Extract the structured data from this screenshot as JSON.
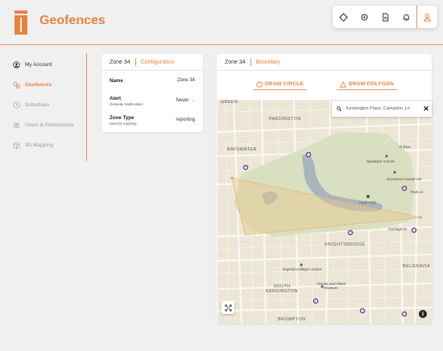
{
  "app": {
    "title": "Geofences"
  },
  "toolbar": {
    "items": [
      {
        "icon": "diamond-icon"
      },
      {
        "icon": "gear-icon"
      },
      {
        "icon": "document-icon"
      },
      {
        "icon": "bell-icon"
      },
      {
        "icon": "user-icon"
      }
    ]
  },
  "sidebar": {
    "items": [
      {
        "label": "My Account",
        "icon": "user-circle-icon"
      },
      {
        "label": "Geofences",
        "icon": "geofence-icon",
        "active": true
      },
      {
        "label": "Schedules",
        "icon": "clock-icon"
      },
      {
        "label": "Users & Permissions",
        "icon": "users-icon"
      },
      {
        "label": "3D Mapping",
        "icon": "cube-icon"
      }
    ]
  },
  "config": {
    "zone": "Zone 34",
    "tab": "Configuration",
    "name_label": "Name",
    "name_value": "Zone 34",
    "alert_label": "Alert",
    "alert_sub": "Generate Notifications",
    "alert_value": "Never",
    "zone_type_label": "Zone Type",
    "zone_type_sub": "Used for reporting",
    "zone_type_value": "reporting"
  },
  "boundary": {
    "zone": "Zone 34",
    "tab": "Boundary",
    "draw_circle": "DRAW CIRCLE",
    "draw_polygon": "DRAW POLYGON",
    "search_value": "Kensington Place, Campden, Lo",
    "clear": "✕"
  },
  "map": {
    "labels": {
      "green": "GREEN",
      "paddington": "PADDINGTON",
      "bayswater": "BAYSWATER",
      "speakers_corner": "Speakers' Corner",
      "grosvenor": "Grosvenor House Hot",
      "hyde_park": "Hyde Park",
      "knightsbridge": "KNIGHTSBRIDGE",
      "carriage": "Carriage Dr",
      "imperial": "Imperial College London",
      "south_kensington": "SOUTH KENSINGTON",
      "va": "Victoria and Albert Museum",
      "belgravia": "BELGRAVIA",
      "brompton": "BROMPTON",
      "park_ln": "Park Ln",
      "n_row": "N Row"
    },
    "colors": {
      "accent": "#e8823f",
      "park": "#d9dfc1",
      "water": "#a9b4bf",
      "polygon_fill": "#e8c98a"
    }
  },
  "controls": {
    "info": "i"
  }
}
